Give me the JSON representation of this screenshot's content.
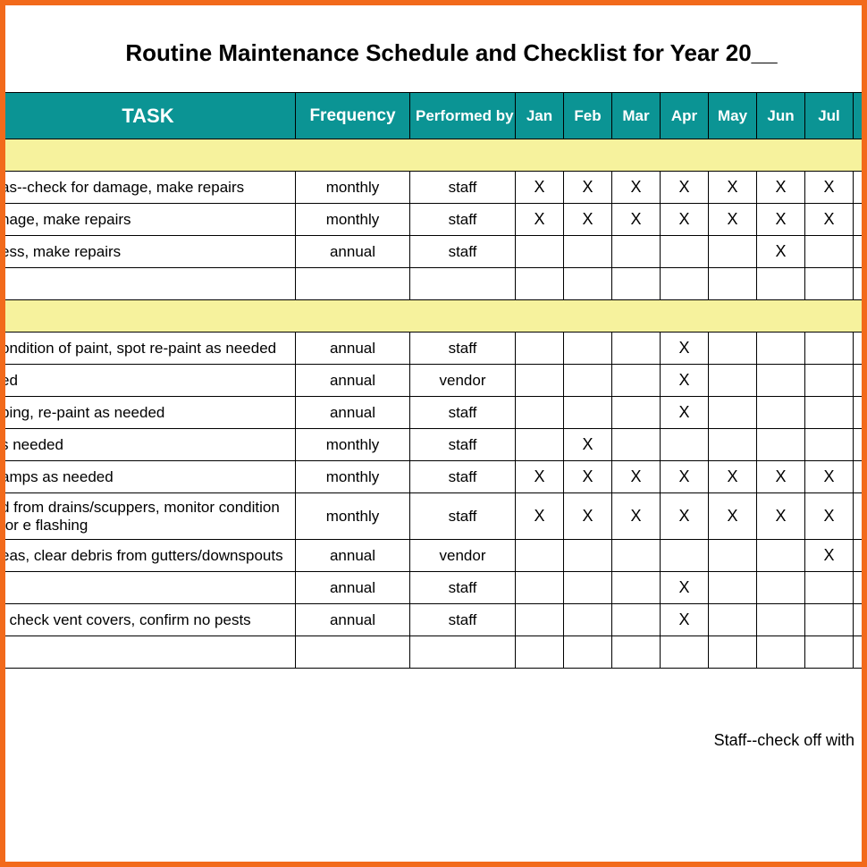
{
  "title": "Routine Maintenance Schedule and Checklist for Year 20__",
  "headers": {
    "task": "TASK",
    "frequency": "Frequency",
    "performed_by": "Performed by",
    "months": [
      "Jan",
      "Feb",
      "Mar",
      "Apr",
      "May",
      "Jun",
      "Jul"
    ]
  },
  "mark": "X",
  "rows_a": [
    {
      "task": "as--check for damage, make repairs",
      "freq": "monthly",
      "perf": "staff",
      "m": [
        "X",
        "X",
        "X",
        "X",
        "X",
        "X",
        "X"
      ]
    },
    {
      "task": "nage, make repairs",
      "freq": "monthly",
      "perf": "staff",
      "m": [
        "X",
        "X",
        "X",
        "X",
        "X",
        "X",
        "X"
      ]
    },
    {
      "task": "ess, make repairs",
      "freq": "annual",
      "perf": "staff",
      "m": [
        "",
        "",
        "",
        "",
        "",
        "X",
        ""
      ]
    },
    {
      "task": "",
      "freq": "",
      "perf": "",
      "m": [
        "",
        "",
        "",
        "",
        "",
        "",
        ""
      ]
    }
  ],
  "rows_b": [
    {
      "task": "ondition of paint, spot re-paint as needed",
      "freq": "annual",
      "perf": "staff",
      "m": [
        "",
        "",
        "",
        "X",
        "",
        "",
        ""
      ]
    },
    {
      "task": "ed",
      "freq": "annual",
      "perf": "vendor",
      "m": [
        "",
        "",
        "",
        "X",
        "",
        "",
        ""
      ]
    },
    {
      "task": "ping, re-paint as needed",
      "freq": "annual",
      "perf": "staff",
      "m": [
        "",
        "",
        "",
        "X",
        "",
        "",
        ""
      ]
    },
    {
      "task": "s needed",
      "freq": "monthly",
      "perf": "staff",
      "m": [
        "",
        "X",
        "",
        "",
        "",
        "",
        ""
      ]
    },
    {
      "task": "amps as needed",
      "freq": "monthly",
      "perf": "staff",
      "m": [
        "X",
        "X",
        "X",
        "X",
        "X",
        "X",
        "X"
      ]
    },
    {
      "task": "d from drains/scuppers, monitor condition for\ne flashing",
      "freq": "monthly",
      "perf": "staff",
      "m": [
        "X",
        "X",
        "X",
        "X",
        "X",
        "X",
        "X"
      ],
      "multi": true
    },
    {
      "task": "eas, clear debris from gutters/downspouts",
      "freq": "annual",
      "perf": "vendor",
      "m": [
        "",
        "",
        "",
        "",
        "",
        "",
        "X"
      ]
    },
    {
      "task": "",
      "freq": "annual",
      "perf": "staff",
      "m": [
        "",
        "",
        "",
        "X",
        "",
        "",
        ""
      ]
    },
    {
      "task": ", check vent covers, confirm no pests",
      "freq": "annual",
      "perf": "staff",
      "m": [
        "",
        "",
        "",
        "X",
        "",
        "",
        ""
      ]
    },
    {
      "task": "",
      "freq": "",
      "perf": "",
      "m": [
        "",
        "",
        "",
        "",
        "",
        "",
        ""
      ]
    }
  ],
  "footer": "Staff--check off with",
  "chart_data": {
    "type": "table",
    "title": "Routine Maintenance Schedule and Checklist for Year 20__",
    "columns": [
      "TASK",
      "Frequency",
      "Performed by",
      "Jan",
      "Feb",
      "Mar",
      "Apr",
      "May",
      "Jun",
      "Jul"
    ],
    "sections": [
      {
        "rows": [
          [
            "...as--check for damage, make repairs",
            "monthly",
            "staff",
            "X",
            "X",
            "X",
            "X",
            "X",
            "X",
            "X"
          ],
          [
            "...nage, make repairs",
            "monthly",
            "staff",
            "X",
            "X",
            "X",
            "X",
            "X",
            "X",
            "X"
          ],
          [
            "...ess, make repairs",
            "annual",
            "staff",
            "",
            "",
            "",
            "",
            "",
            "X",
            ""
          ],
          [
            "",
            "",
            "",
            "",
            "",
            "",
            "",
            "",
            "",
            ""
          ]
        ]
      },
      {
        "rows": [
          [
            "...ondition of paint, spot re-paint as needed",
            "annual",
            "staff",
            "",
            "",
            "",
            "X",
            "",
            "",
            ""
          ],
          [
            "...ed",
            "annual",
            "vendor",
            "",
            "",
            "",
            "X",
            "",
            "",
            ""
          ],
          [
            "...ping, re-paint as needed",
            "annual",
            "staff",
            "",
            "",
            "",
            "X",
            "",
            "",
            ""
          ],
          [
            "...s needed",
            "monthly",
            "staff",
            "",
            "X",
            "",
            "",
            "",
            "",
            ""
          ],
          [
            "...amps as needed",
            "monthly",
            "staff",
            "X",
            "X",
            "X",
            "X",
            "X",
            "X",
            "X"
          ],
          [
            "...d from drains/scuppers, monitor condition for ...e flashing",
            "monthly",
            "staff",
            "X",
            "X",
            "X",
            "X",
            "X",
            "X",
            "X"
          ],
          [
            "...eas, clear debris from gutters/downspouts",
            "annual",
            "vendor",
            "",
            "",
            "",
            "",
            "",
            "",
            "X"
          ],
          [
            "",
            "annual",
            "staff",
            "",
            "",
            "",
            "X",
            "",
            "",
            ""
          ],
          [
            "..., check vent covers, confirm no pests",
            "annual",
            "staff",
            "",
            "",
            "",
            "X",
            "",
            "",
            ""
          ],
          [
            "",
            "",
            "",
            "",
            "",
            "",
            "",
            "",
            "",
            ""
          ]
        ]
      }
    ]
  }
}
